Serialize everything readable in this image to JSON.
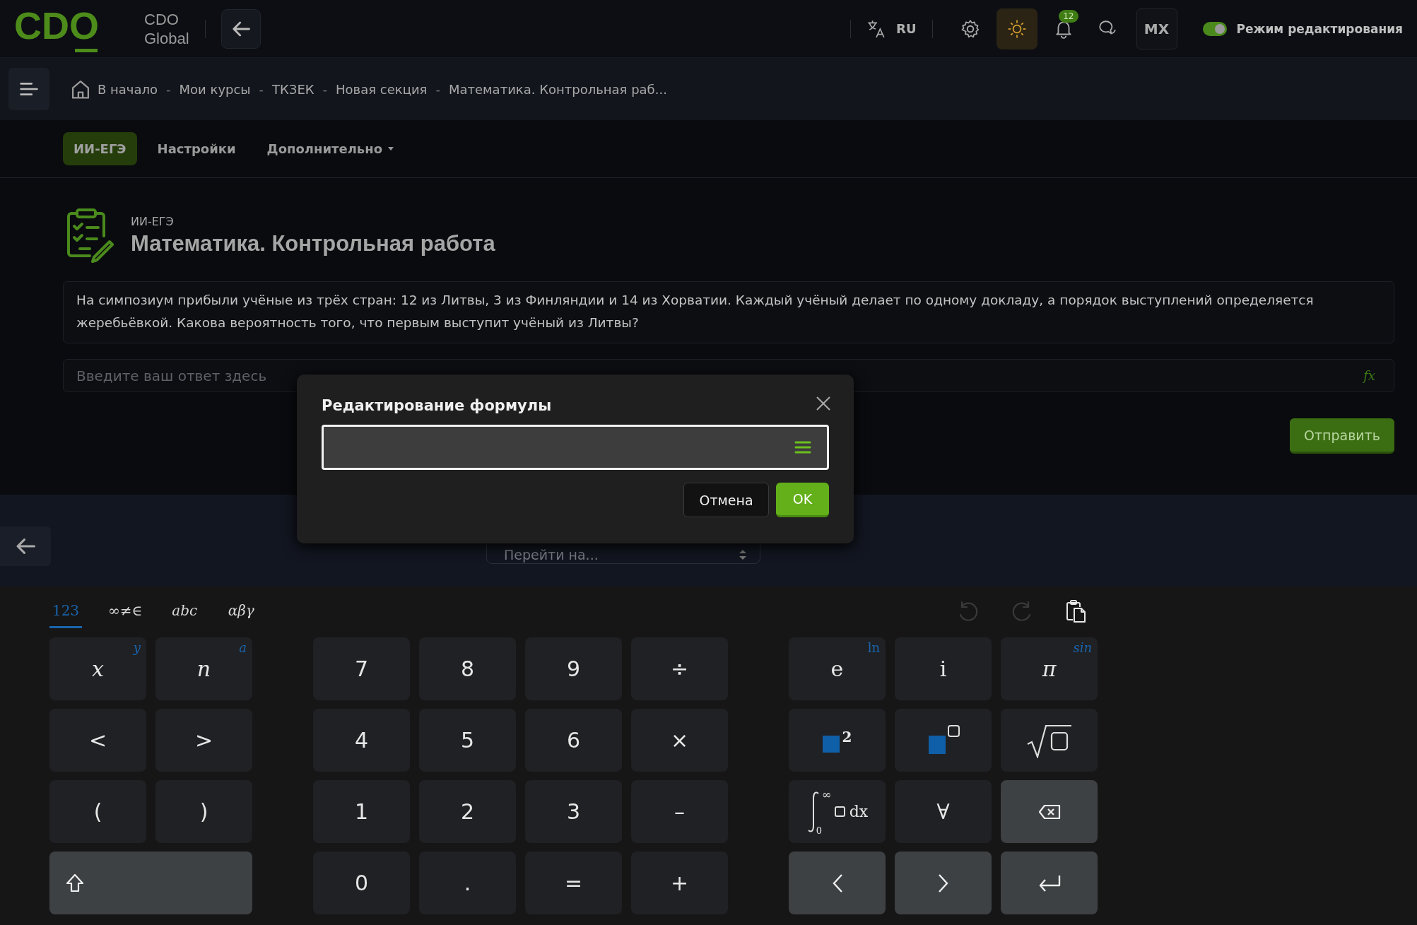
{
  "header": {
    "logo": "CDO",
    "brand": "CDO Global",
    "language": "RU",
    "notifications": "12",
    "avatar": "MX",
    "edit_mode": {
      "label": "Режим редактирования",
      "on": true
    }
  },
  "breadcrumbs": [
    {
      "label": "В начало"
    },
    {
      "separator": "-",
      "label": "Мои курсы"
    },
    {
      "separator": "-",
      "label": "ТКЗЕК"
    },
    {
      "separator": "-",
      "label": "Новая секция"
    },
    {
      "separator": "-",
      "label": "Математика. Контрольная раб..."
    }
  ],
  "tabs": [
    {
      "label": "ИИ-ЕГЭ",
      "selected": true
    },
    {
      "label": "Настройки",
      "selected": false
    },
    {
      "label": "Дополнительно",
      "selected": false,
      "dropdown": true
    }
  ],
  "activity": {
    "type": "ИИ-ЕГЭ",
    "title": "Математика. Контрольная работа",
    "question": "На симпозиум прибыли учёные из трёх стран: 12 из Литвы, 3 из Финляндии и 14 из Хорватии. Каждый учёный делает по одному докладу, а порядок выступлений определяется жеребьёвкой. Какова вероятность того, что первым выступит учёный из Литвы?",
    "answer_placeholder": "Введите ваш ответ здесь",
    "formula_button": "fx",
    "submit": "Отправить"
  },
  "navigation": {
    "jump_placeholder": "Перейти на..."
  },
  "dialog": {
    "title": "Редактирование формулы",
    "cancel": "Отмена",
    "ok": "OK"
  },
  "keyboard": {
    "tabs": [
      {
        "label": "123",
        "selected": true
      },
      {
        "label": "∞≠∈",
        "selected": false
      },
      {
        "label": "abc",
        "selected": false
      },
      {
        "label": "αβγ",
        "selected": false
      }
    ],
    "groups": [
      {
        "kind": "letters",
        "keys": [
          {
            "kind": "var",
            "label": "x",
            "shift": "y"
          },
          {
            "kind": "var",
            "label": "n",
            "shift": "a"
          },
          {
            "kind": "text",
            "label": "<"
          },
          {
            "kind": "text",
            "label": ">"
          },
          {
            "kind": "text",
            "label": "("
          },
          {
            "kind": "text",
            "label": ")"
          },
          {
            "kind": "shift"
          }
        ]
      },
      {
        "kind": "digits",
        "keys": [
          {
            "kind": "text",
            "label": "7"
          },
          {
            "kind": "text",
            "label": "8"
          },
          {
            "kind": "text",
            "label": "9"
          },
          {
            "kind": "text",
            "label": "÷"
          },
          {
            "kind": "text",
            "label": "4"
          },
          {
            "kind": "text",
            "label": "5"
          },
          {
            "kind": "text",
            "label": "6"
          },
          {
            "kind": "text",
            "label": "×"
          },
          {
            "kind": "text",
            "label": "1"
          },
          {
            "kind": "text",
            "label": "2"
          },
          {
            "kind": "text",
            "label": "3"
          },
          {
            "kind": "text",
            "label": "–"
          },
          {
            "kind": "text",
            "label": "0"
          },
          {
            "kind": "text",
            "label": "."
          },
          {
            "kind": "text",
            "label": "="
          },
          {
            "kind": "text",
            "label": "+"
          }
        ]
      },
      {
        "kind": "functions",
        "keys": [
          {
            "kind": "const",
            "label": "e",
            "shift": "ln"
          },
          {
            "kind": "const",
            "label": "i"
          },
          {
            "kind": "var",
            "label": "π",
            "shift": "sin"
          },
          {
            "kind": "square",
            "label": "2"
          },
          {
            "kind": "power"
          },
          {
            "kind": "sqrt"
          },
          {
            "kind": "integral",
            "upper": "∞",
            "lower": "0",
            "label": "dx"
          },
          {
            "kind": "const",
            "label": "∀"
          },
          {
            "kind": "backspace"
          },
          {
            "kind": "left"
          },
          {
            "kind": "right"
          },
          {
            "kind": "enter"
          }
        ]
      }
    ]
  }
}
